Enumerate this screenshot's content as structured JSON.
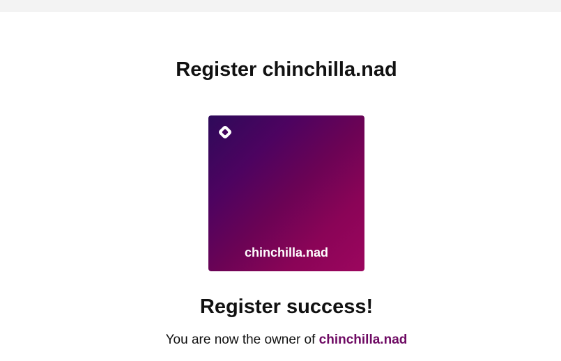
{
  "page": {
    "title": "Register chinchilla.nad"
  },
  "card": {
    "logo_icon": "nad-logo-icon",
    "name": "chinchilla.nad",
    "gradient_colors": [
      "#2e0a5a",
      "#6b0355",
      "#9c065e"
    ]
  },
  "result": {
    "heading": "Register success!",
    "owner_text": "You are now the owner of",
    "domain": "chinchilla.nad",
    "domain_color": "#6e0a63"
  }
}
